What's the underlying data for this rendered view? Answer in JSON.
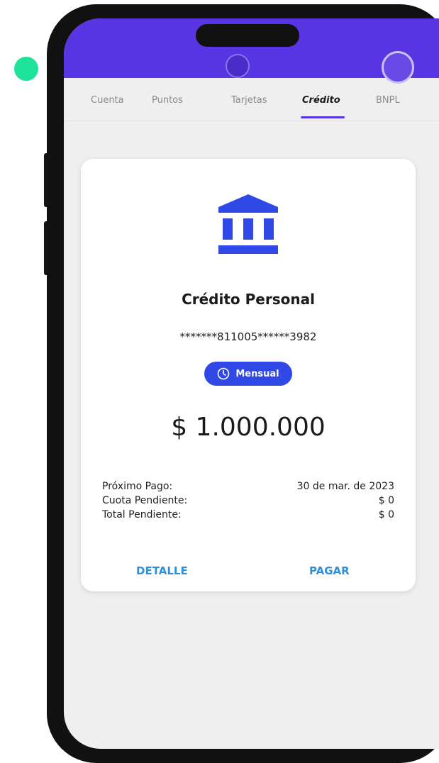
{
  "colors": {
    "header": "#5934e3",
    "accent_blue": "#3048e6",
    "link": "#2f8fd9",
    "dot": "#1de39b"
  },
  "tabs": [
    {
      "label": "Cuenta",
      "active": false
    },
    {
      "label": "Puntos",
      "active": false
    },
    {
      "label": "Tarjetas",
      "active": false
    },
    {
      "label": "Crédito",
      "active": true
    },
    {
      "label": "BNPL",
      "active": false
    }
  ],
  "card": {
    "icon": "bank-icon",
    "title": "Crédito Personal",
    "account_number": "*******811005******3982",
    "frequency_icon": "clock-icon",
    "frequency": "Mensual",
    "amount": "$ 1.000.000",
    "details": [
      {
        "label": "Próximo Pago:",
        "value": "30 de mar. de 2023"
      },
      {
        "label": "Cuota Pendiente:",
        "value": "$ 0"
      },
      {
        "label": "Total Pendiente:",
        "value": "$ 0"
      }
    ],
    "detail_button": "DETALLE",
    "pay_button": "PAGAR"
  }
}
